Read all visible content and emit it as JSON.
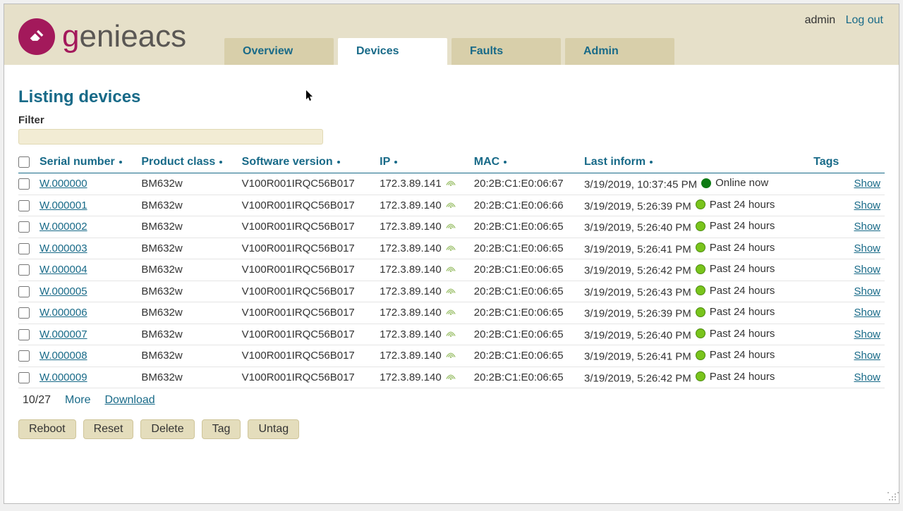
{
  "user": {
    "name": "admin",
    "logout": "Log out"
  },
  "brand": {
    "name": "genieacs"
  },
  "nav": {
    "tabs": [
      {
        "label": "Overview",
        "active": false
      },
      {
        "label": "Devices",
        "active": true
      },
      {
        "label": "Faults",
        "active": false
      },
      {
        "label": "Admin",
        "active": false
      }
    ]
  },
  "page": {
    "title": "Listing devices",
    "filter_label": "Filter",
    "filter_value": "",
    "count_label": "10/27",
    "more_label": "More",
    "download_label": "Download"
  },
  "table": {
    "headers": {
      "serial": "Serial number",
      "product": "Product class",
      "software": "Software version",
      "ip": "IP",
      "mac": "MAC",
      "last_inform": "Last inform",
      "tags": "Tags"
    },
    "show_label": "Show",
    "rows": [
      {
        "serial": "W.000000",
        "product": "BM632w",
        "software": "V100R001IRQC56B017",
        "ip": "172.3.89.141",
        "mac": "20:2B:C1:E0:06:67",
        "last_inform": "3/19/2019, 10:37:45 PM",
        "status": "online",
        "status_text": "Online now"
      },
      {
        "serial": "W.000001",
        "product": "BM632w",
        "software": "V100R001IRQC56B017",
        "ip": "172.3.89.140",
        "mac": "20:2B:C1:E0:06:66",
        "last_inform": "3/19/2019, 5:26:39 PM",
        "status": "past",
        "status_text": "Past 24 hours"
      },
      {
        "serial": "W.000002",
        "product": "BM632w",
        "software": "V100R001IRQC56B017",
        "ip": "172.3.89.140",
        "mac": "20:2B:C1:E0:06:65",
        "last_inform": "3/19/2019, 5:26:40 PM",
        "status": "past",
        "status_text": "Past 24 hours"
      },
      {
        "serial": "W.000003",
        "product": "BM632w",
        "software": "V100R001IRQC56B017",
        "ip": "172.3.89.140",
        "mac": "20:2B:C1:E0:06:65",
        "last_inform": "3/19/2019, 5:26:41 PM",
        "status": "past",
        "status_text": "Past 24 hours"
      },
      {
        "serial": "W.000004",
        "product": "BM632w",
        "software": "V100R001IRQC56B017",
        "ip": "172.3.89.140",
        "mac": "20:2B:C1:E0:06:65",
        "last_inform": "3/19/2019, 5:26:42 PM",
        "status": "past",
        "status_text": "Past 24 hours"
      },
      {
        "serial": "W.000005",
        "product": "BM632w",
        "software": "V100R001IRQC56B017",
        "ip": "172.3.89.140",
        "mac": "20:2B:C1:E0:06:65",
        "last_inform": "3/19/2019, 5:26:43 PM",
        "status": "past",
        "status_text": "Past 24 hours"
      },
      {
        "serial": "W.000006",
        "product": "BM632w",
        "software": "V100R001IRQC56B017",
        "ip": "172.3.89.140",
        "mac": "20:2B:C1:E0:06:65",
        "last_inform": "3/19/2019, 5:26:39 PM",
        "status": "past",
        "status_text": "Past 24 hours"
      },
      {
        "serial": "W.000007",
        "product": "BM632w",
        "software": "V100R001IRQC56B017",
        "ip": "172.3.89.140",
        "mac": "20:2B:C1:E0:06:65",
        "last_inform": "3/19/2019, 5:26:40 PM",
        "status": "past",
        "status_text": "Past 24 hours"
      },
      {
        "serial": "W.000008",
        "product": "BM632w",
        "software": "V100R001IRQC56B017",
        "ip": "172.3.89.140",
        "mac": "20:2B:C1:E0:06:65",
        "last_inform": "3/19/2019, 5:26:41 PM",
        "status": "past",
        "status_text": "Past 24 hours"
      },
      {
        "serial": "W.000009",
        "product": "BM632w",
        "software": "V100R001IRQC56B017",
        "ip": "172.3.89.140",
        "mac": "20:2B:C1:E0:06:65",
        "last_inform": "3/19/2019, 5:26:42 PM",
        "status": "past",
        "status_text": "Past 24 hours"
      }
    ]
  },
  "actions": {
    "reboot": "Reboot",
    "reset": "Reset",
    "delete": "Delete",
    "tag": "Tag",
    "untag": "Untag"
  }
}
